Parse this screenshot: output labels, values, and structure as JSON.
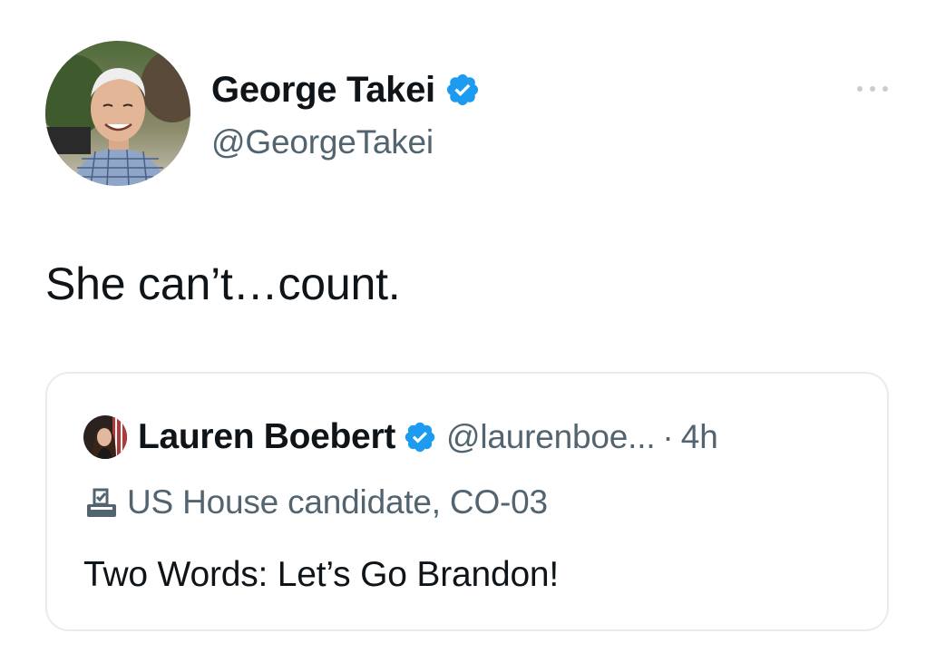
{
  "tweet": {
    "author": {
      "display_name": "George Takei",
      "handle": "@GeorgeTakei",
      "verified": true,
      "avatar_icon": "profile-photo"
    },
    "more_icon": "ellipsis-icon",
    "text": "She can’t…count."
  },
  "quoted_tweet": {
    "author": {
      "display_name": "Lauren Boebert",
      "handle": "@laurenboe...",
      "verified": true,
      "avatar_icon": "profile-photo"
    },
    "separator": "·",
    "time": "4h",
    "label_icon": "ballot-box-icon",
    "label": "US House candidate, CO-03",
    "text": "Two Words: Let’s Go Brandon!"
  },
  "colors": {
    "verified_blue": "#1d9bf0",
    "secondary_text": "#536471",
    "primary_text": "#0f1419",
    "border": "#e6ecf0"
  }
}
